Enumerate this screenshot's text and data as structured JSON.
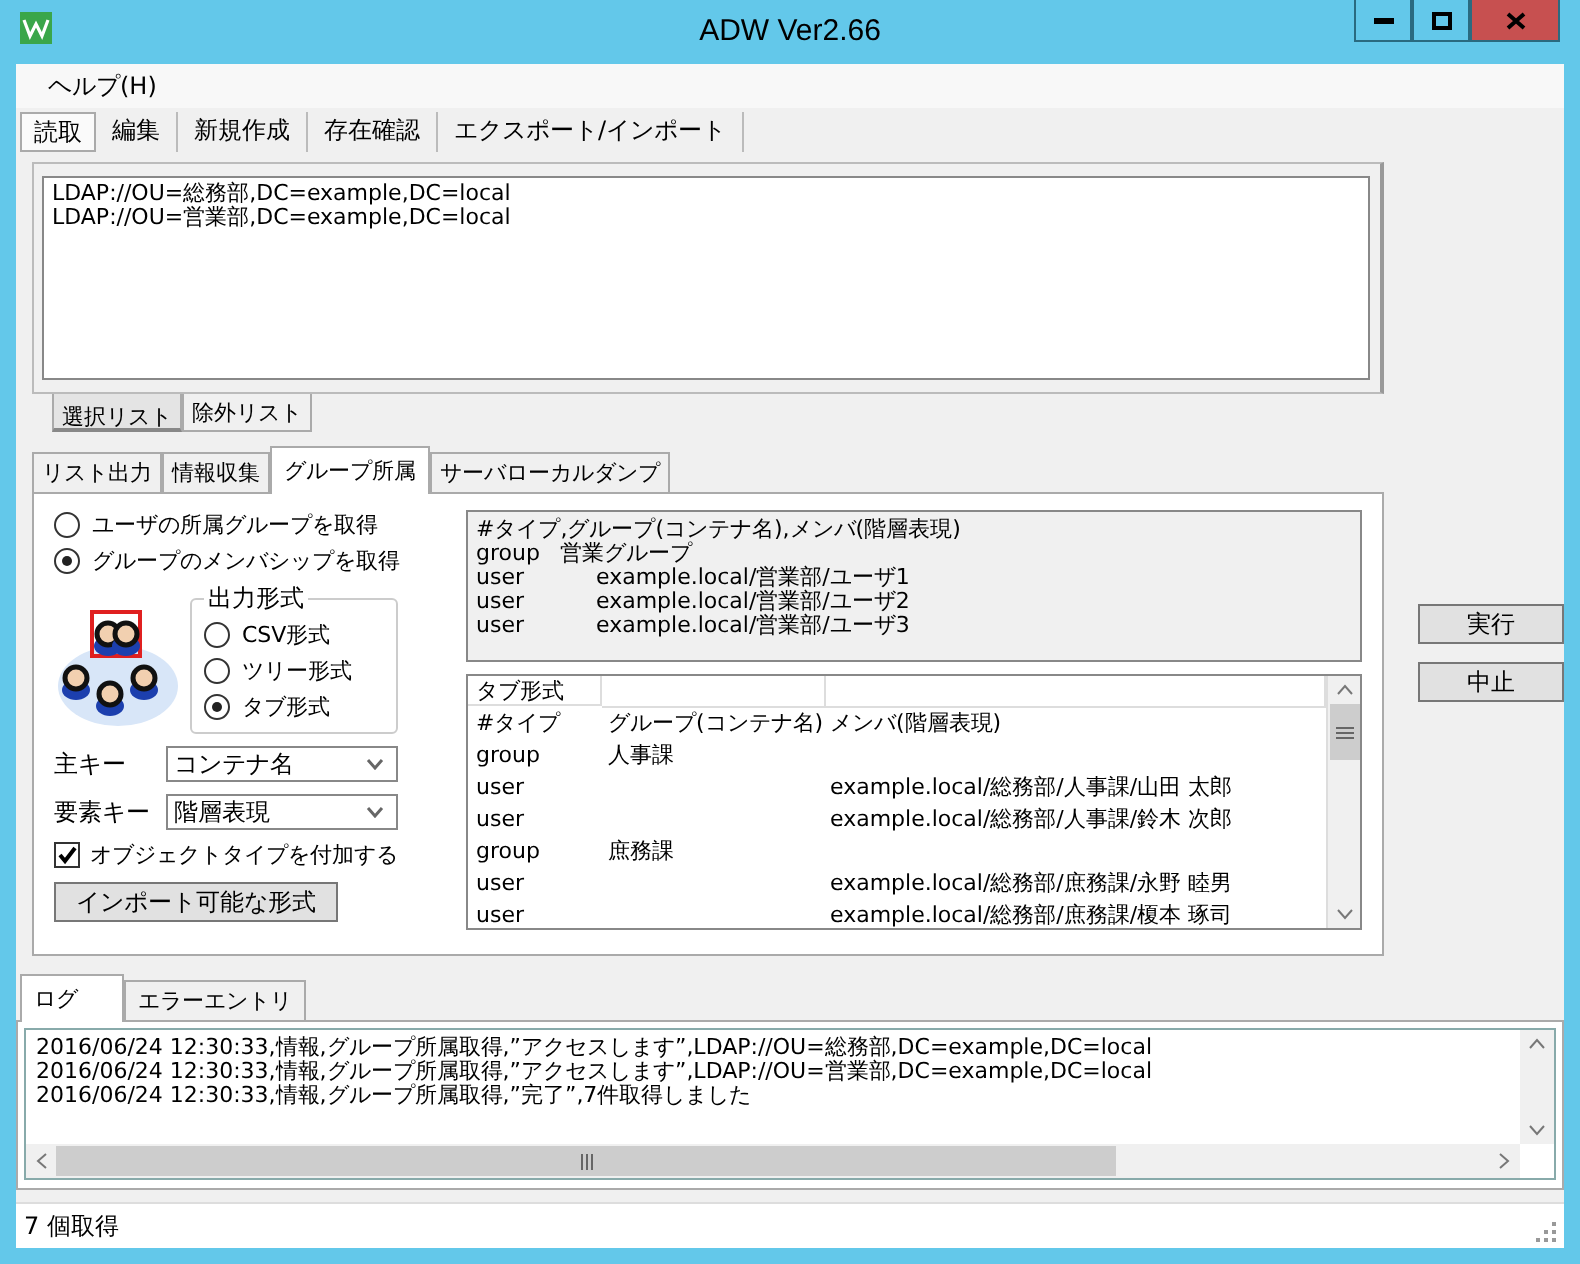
{
  "window": {
    "title": "ADW Ver2.66"
  },
  "menu": [
    "ヘルプ(H)"
  ],
  "main_tabs": [
    {
      "label": "読取",
      "selected": true
    },
    {
      "label": "編集",
      "selected": false
    },
    {
      "label": "新規作成",
      "selected": false
    },
    {
      "label": "存在確認",
      "selected": false
    },
    {
      "label": "エクスポート/インポート",
      "selected": false
    }
  ],
  "ldap_paths": [
    "LDAP://OU=総務部,DC=example,DC=local",
    "LDAP://OU=営業部,DC=example,DC=local"
  ],
  "list_tabs": [
    {
      "label": "選択リスト",
      "selected": true
    },
    {
      "label": "除外リスト",
      "selected": false
    }
  ],
  "function_tabs": [
    {
      "label": "リスト出力",
      "selected": false
    },
    {
      "label": "情報収集",
      "selected": false
    },
    {
      "label": "グループ所属",
      "selected": true
    },
    {
      "label": "サーバローカルダンプ",
      "selected": false
    }
  ],
  "mode_options": [
    {
      "label": "ユーザの所属グループを取得",
      "selected": false
    },
    {
      "label": "グループのメンバシップを取得",
      "selected": true
    }
  ],
  "output_format": {
    "title": "出力形式",
    "options": [
      {
        "label": "CSV形式",
        "selected": false
      },
      {
        "label": "ツリー形式",
        "selected": false
      },
      {
        "label": "タブ形式",
        "selected": true
      }
    ]
  },
  "fields": [
    {
      "label": "主キー",
      "value": "コンテナ名"
    },
    {
      "label": "要素キー",
      "value": "階層表現"
    }
  ],
  "add_type_checkbox": {
    "label": "オブジェクトタイプを付加する",
    "checked": true
  },
  "import_button": "インポート可能な形式",
  "preview": {
    "header": "#タイプ,グループ(コンテナ名),メンバ(階層表現)",
    "rows": [
      {
        "type": "group",
        "value": "営業グループ"
      },
      {
        "type": "user",
        "value": "example.local/営業部/ユーザ1"
      },
      {
        "type": "user",
        "value": "example.local/営業部/ユーザ2"
      },
      {
        "type": "user",
        "value": "example.local/営業部/ユーザ3"
      }
    ]
  },
  "table": {
    "columns": [
      {
        "label": "タブ形式"
      }
    ],
    "rows": [
      {
        "type": "#タイプ",
        "group": "グループ(コンテナ名)",
        "member": "メンバ(階層表現)"
      },
      {
        "type": "group",
        "group": "人事課"
      },
      {
        "type": "user",
        "member": "example.local/総務部/人事課/山田 太郎"
      },
      {
        "type": "user",
        "member": "example.local/総務部/人事課/鈴木 次郎"
      },
      {
        "type": "group",
        "group": "庶務課"
      },
      {
        "type": "user",
        "member": "example.local/総務部/庶務課/永野 睦男"
      },
      {
        "type": "user",
        "member": "example.local/総務部/庶務課/榎本 琢司"
      }
    ]
  },
  "buttons": [
    "実行",
    "中止"
  ],
  "log_tabs": [
    {
      "label": "ログ",
      "selected": true
    },
    {
      "label": "エラーエントリ",
      "selected": false
    }
  ],
  "log_lines": [
    "2016/06/24 12:30:33,情報,グループ所属取得,”アクセスします”,LDAP://OU=総務部,DC=example,DC=local",
    "2016/06/24 12:30:33,情報,グループ所属取得,”アクセスします”,LDAP://OU=営業部,DC=example,DC=local",
    "2016/06/24 12:30:33,情報,グループ所属取得,”完了”,7件取得しました"
  ],
  "status_bar": "7 個取得"
}
